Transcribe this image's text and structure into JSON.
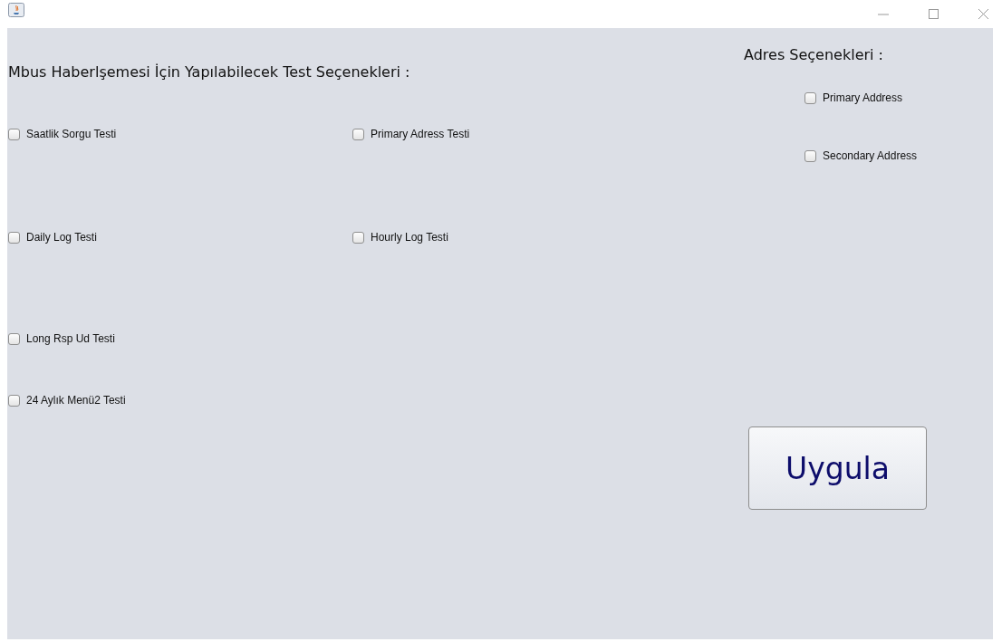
{
  "tests": {
    "title": "Mbus Haberlşemesi İçin Yapılabilecek Test Seçenekleri :",
    "rows": [
      [
        {
          "label": "Saatlik Sorgu Testi",
          "checked": false
        },
        {
          "label": "Primary Adress Testi",
          "checked": false
        }
      ],
      [
        {
          "label": "Daily Log Testi",
          "checked": false
        },
        {
          "label": "Hourly Log Testi",
          "checked": false
        }
      ],
      [
        {
          "label": "Long Rsp Ud Testi",
          "checked": false
        }
      ],
      [
        {
          "label": "24 Aylık Menü2 Testi",
          "checked": false
        }
      ]
    ]
  },
  "address": {
    "title": "Adres Seçenekleri :",
    "options": [
      {
        "label": "Primary Address",
        "checked": false
      },
      {
        "label": "Secondary Address",
        "checked": false
      }
    ]
  },
  "apply_button": {
    "label": "Uygula"
  }
}
